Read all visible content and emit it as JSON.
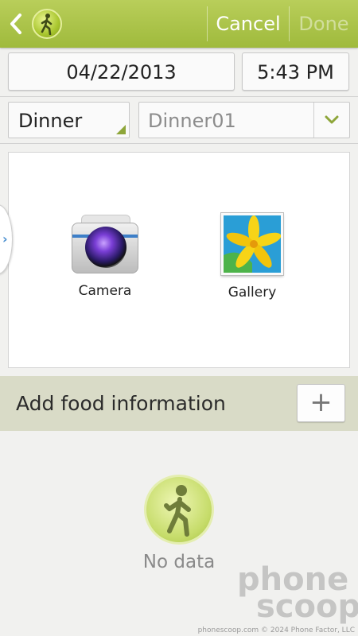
{
  "action_bar": {
    "back_icon": "chevron-left-icon",
    "app_icon": "walking-person-icon",
    "cancel_label": "Cancel",
    "done_label": "Done",
    "bar_color": "#a9c24a"
  },
  "datetime": {
    "date": "04/22/2013",
    "time": "5:43 PM"
  },
  "meal": {
    "type": "Dinner",
    "name": "Dinner01"
  },
  "photo_sources": [
    {
      "label": "Camera",
      "icon": "camera-icon"
    },
    {
      "label": "Gallery",
      "icon": "gallery-icon"
    }
  ],
  "food_info": {
    "title": "Add food information",
    "add_label": "+"
  },
  "empty_state": {
    "text": "No data",
    "icon": "walking-person-icon"
  },
  "watermark": {
    "line1": "phone",
    "line2": "scoop",
    "credits": "phonescoop.com  © 2024 Phone Factor, LLC"
  }
}
